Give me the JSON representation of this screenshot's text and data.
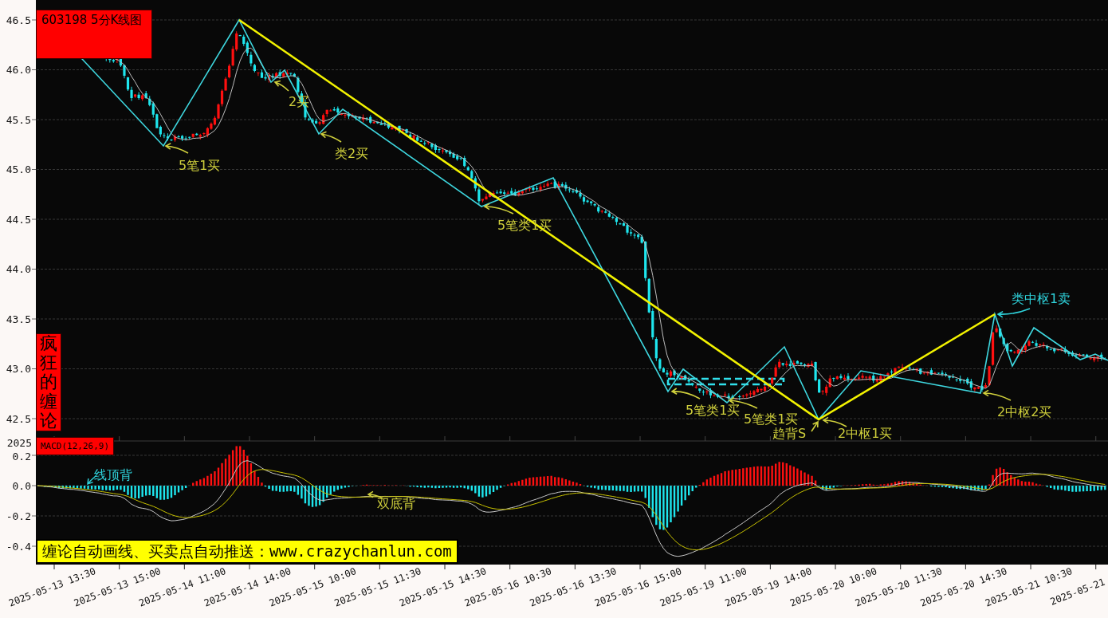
{
  "title_box": {
    "text": "603198 5分K线图"
  },
  "side_label": {
    "text": "疯狂的缠论"
  },
  "price_panel": {
    "y_ticks": [
      "46.5",
      "46.0",
      "45.5",
      "45.0",
      "44.5",
      "44.0",
      "43.5",
      "43.0",
      "42.5"
    ],
    "signals": [
      {
        "text": "5笔1买",
        "kind": "buy"
      },
      {
        "text": "2买",
        "kind": "buy"
      },
      {
        "text": "类2买",
        "kind": "buy"
      },
      {
        "text": "5笔类1买",
        "kind": "buy"
      },
      {
        "text": "5笔类1买",
        "kind": "buy"
      },
      {
        "text": "5笔类1买",
        "kind": "buy"
      },
      {
        "text": "趋背S",
        "kind": "buy"
      },
      {
        "text": "2中枢1买",
        "kind": "buy"
      },
      {
        "text": "2中枢2买",
        "kind": "buy"
      },
      {
        "text": "类中枢1卖",
        "kind": "sell"
      }
    ]
  },
  "macd_panel": {
    "label": "MACD(12,26,9)",
    "axis_overlay": "2025",
    "y_ticks": [
      "0.2",
      "0.0",
      "-0.2",
      "-0.4"
    ],
    "signals": [
      {
        "text": "线顶背",
        "kind": "sell"
      },
      {
        "text": "双底背",
        "kind": "buy"
      }
    ]
  },
  "banner": {
    "text": "缠论自动画线、买卖点自动推送：www.crazychanlun.com"
  },
  "x_axis": {
    "labels": [
      "2025-05-13 13:30",
      "2025-05-13 15:00",
      "2025-05-14 11:00",
      "2025-05-14 14:00",
      "2025-05-15 10:00",
      "2025-05-15 11:30",
      "2025-05-15 14:30",
      "2025-05-16 10:30",
      "2025-05-16 13:30",
      "2025-05-16 15:00",
      "2025-05-19 11:00",
      "2025-05-19 14:00",
      "2025-05-20 10:00",
      "2025-05-20 11:30",
      "2025-05-20 14:30",
      "2025-05-21 10:30",
      "2025-05-21"
    ]
  }
}
